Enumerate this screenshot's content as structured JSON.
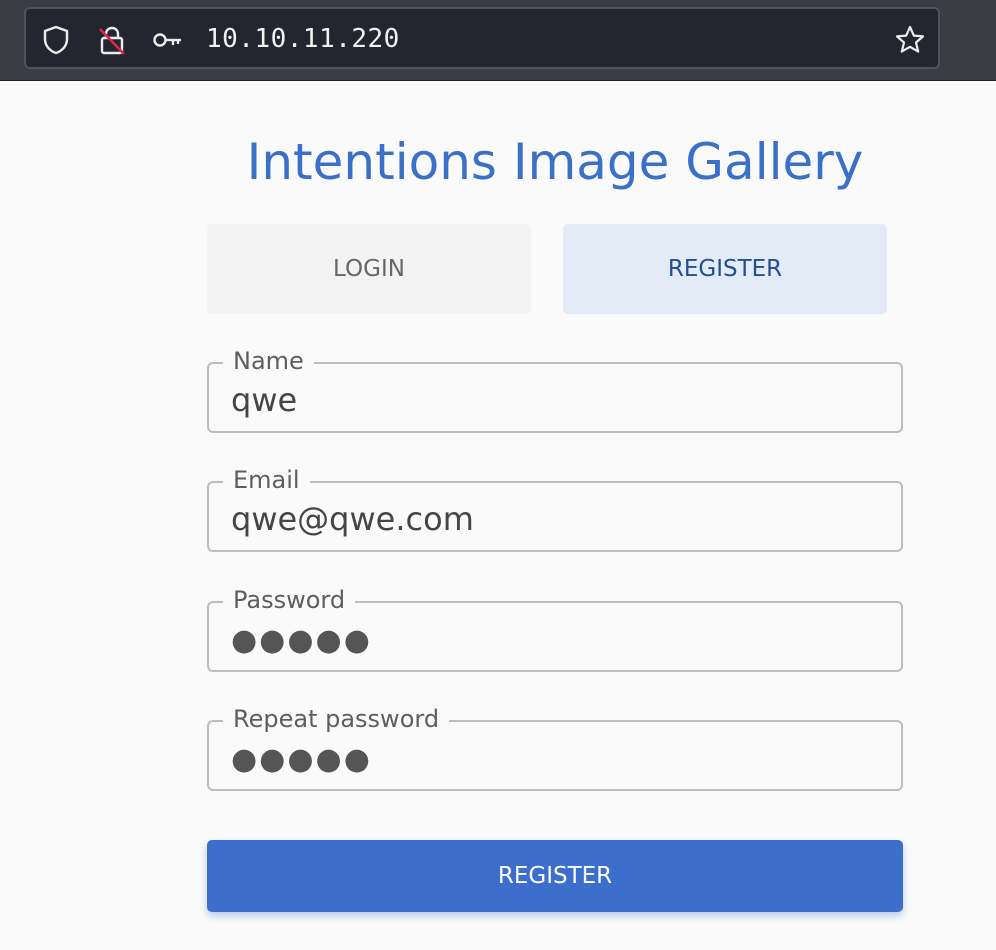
{
  "browser": {
    "url": "10.10.11.220",
    "icons": [
      "shield-icon",
      "lock-slashed-icon",
      "key-icon",
      "star-icon"
    ]
  },
  "page": {
    "title": "Intentions Image Gallery",
    "tabs": {
      "login": "LOGIN",
      "register": "REGISTER",
      "active": "register"
    },
    "form": {
      "name": {
        "label": "Name",
        "value": "qwe"
      },
      "email": {
        "label": "Email",
        "value": "qwe@qwe.com"
      },
      "password": {
        "label": "Password",
        "value": "●●●●●"
      },
      "repeat_password": {
        "label": "Repeat password",
        "value": "●●●●●"
      }
    },
    "submit_label": "REGISTER"
  },
  "colors": {
    "accent": "#3b70c8",
    "active_tab_bg": "#e3ebf6",
    "browser_bar": "#3a3d44"
  }
}
